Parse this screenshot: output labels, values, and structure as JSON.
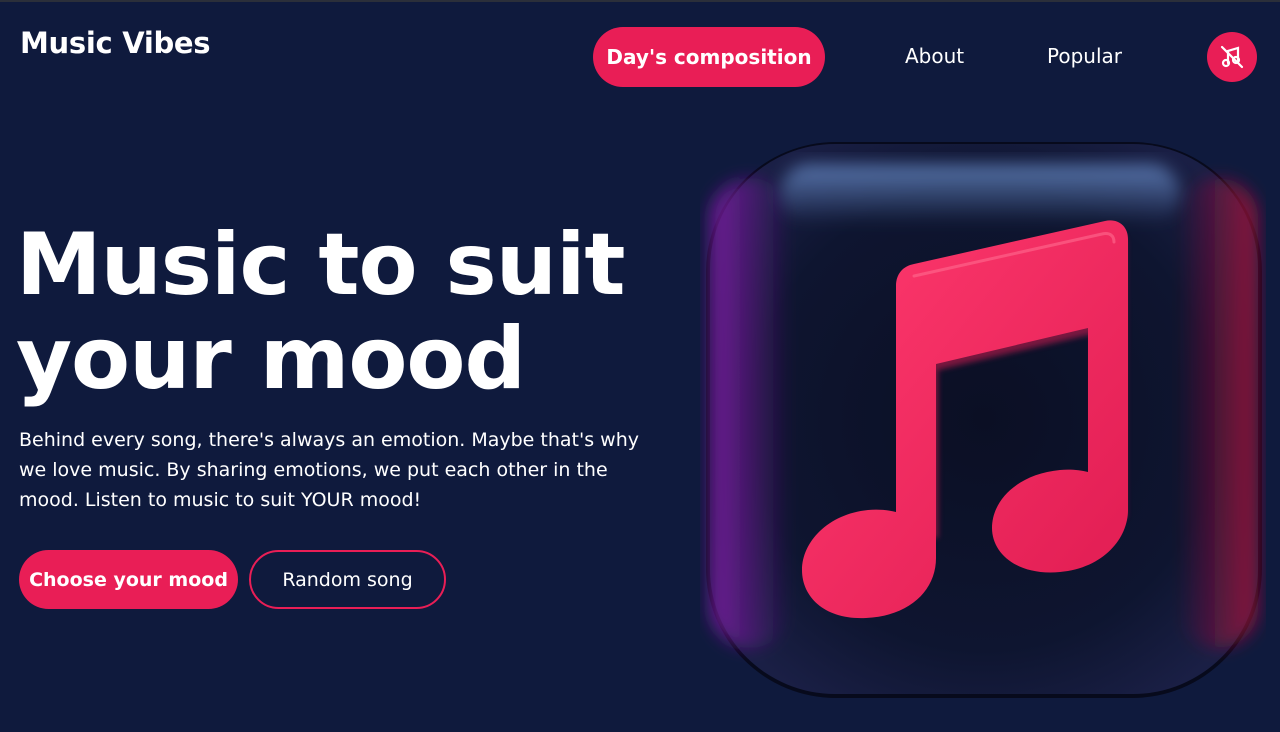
{
  "header": {
    "logo": "Music Vibes",
    "nav": {
      "active": "Day's composition",
      "about": "About",
      "popular": "Popular"
    },
    "profile_icon": "no-music-icon"
  },
  "hero": {
    "title_line1": "Music to suit",
    "title_line2": "your mood",
    "description": "Behind every song, there's always an emotion. Maybe that's why we love music. By sharing emotions, we put each other in the mood. Listen to music to suit YOUR mood!",
    "primary_button": "Choose your mood",
    "secondary_button": "Random song",
    "art_icon": "music-note-icon"
  },
  "colors": {
    "background": "#0f1a3d",
    "accent": "#e91e56"
  }
}
